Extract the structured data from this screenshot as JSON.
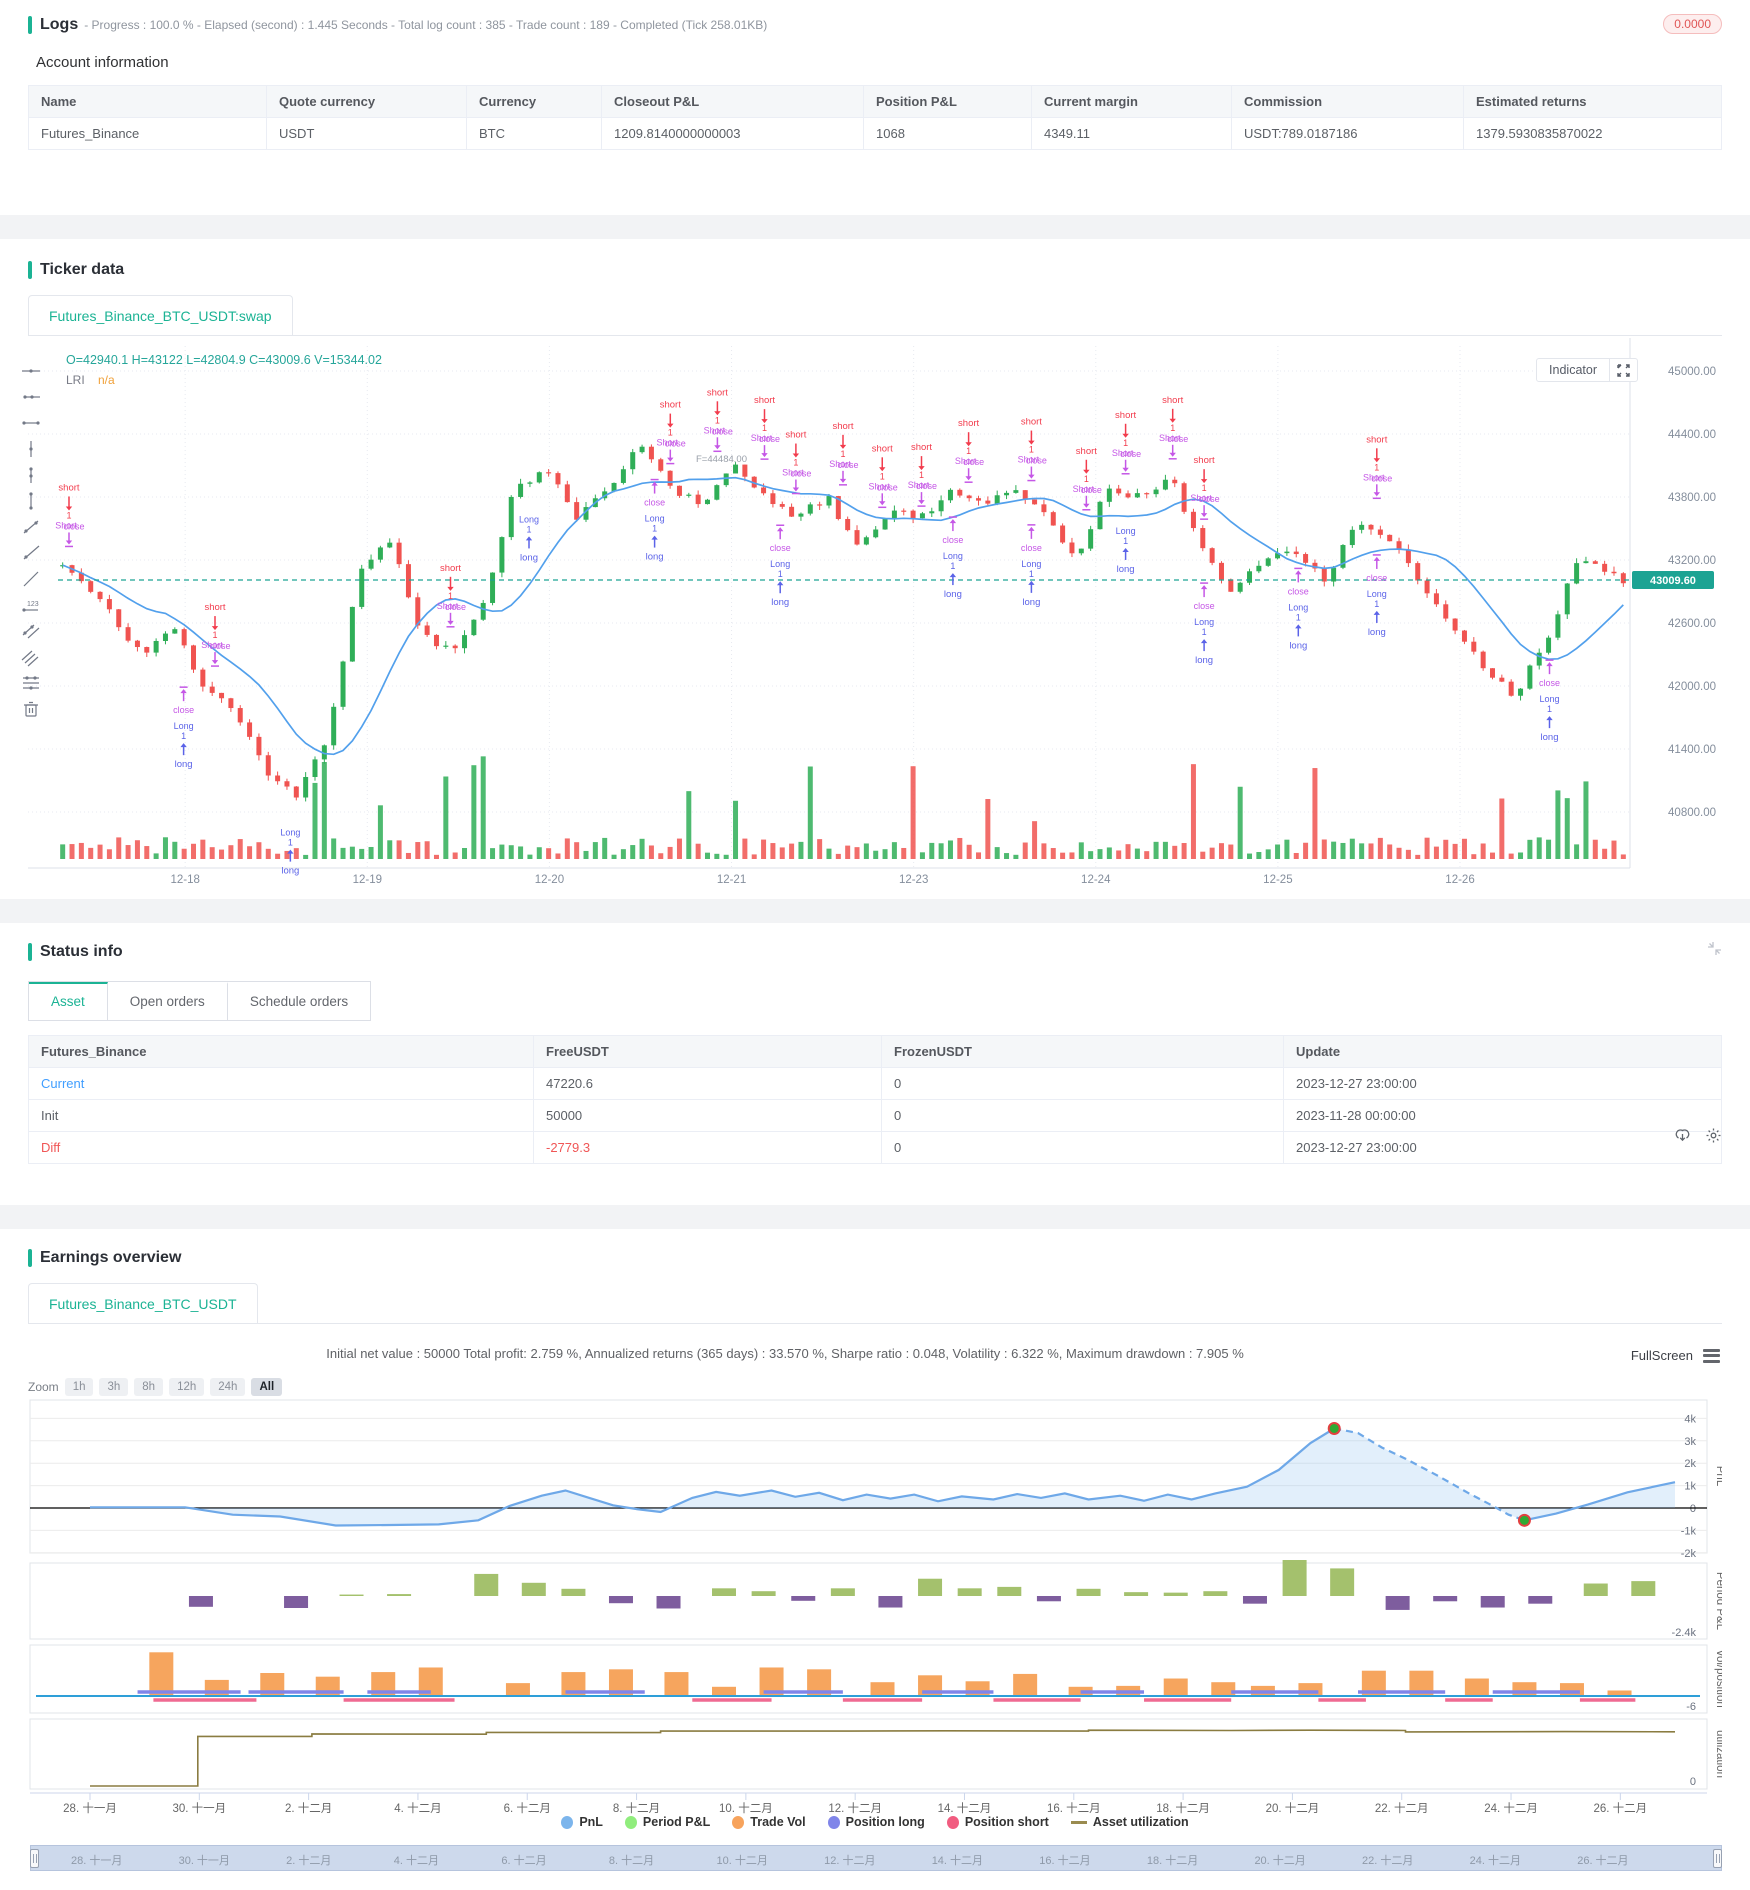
{
  "logs": {
    "title": "Logs",
    "meta": "- Progress : 100.0 % - Elapsed (second) : 1.445  Seconds - Total log count : 385 - Trade count : 189 - Completed (Tick 258.01KB)",
    "badge": "0.0000"
  },
  "account": {
    "subtitle": "Account information",
    "columns": [
      "Name",
      "Quote currency",
      "Currency",
      "Closeout P&L",
      "Position P&L",
      "Current margin",
      "Commission",
      "Estimated returns"
    ],
    "rows": [
      [
        "Futures_Binance",
        "USDT",
        "BTC",
        "1209.8140000000003",
        "1068",
        "4349.11",
        "USDT:789.0187186",
        "1379.5930835870022"
      ]
    ]
  },
  "ticker": {
    "title": "Ticker data",
    "tab": "Futures_Binance_BTC_USDT:swap",
    "ohlc_legend": "O=42940.1 H=43122 L=42804.9 C=43009.6 V=15344.02",
    "indicator_name": "LRI",
    "indicator_value": "n/a",
    "indicator_button": "Indicator",
    "annotation": "F=44484.00",
    "price_tag": "43009.60",
    "toolbar_icons": [
      "crosshair-line",
      "horizontal-ray",
      "horizontal-segment",
      "vertical-line",
      "vertical-ray",
      "vertical-segment",
      "trend-line",
      "ray-line",
      "arrow-line",
      "measure-123",
      "parallel-channel",
      "triple-lines",
      "fib-lines",
      "trash"
    ]
  },
  "status": {
    "title": "Status info",
    "tabs": [
      "Asset",
      "Open orders",
      "Schedule orders"
    ],
    "active_tab": "Asset",
    "columns": [
      "Futures_Binance",
      "FreeUSDT",
      "FrozenUSDT",
      "Update"
    ],
    "rows": [
      {
        "label": "Current",
        "style": "blue",
        "cells": [
          "47220.6",
          "0",
          "2023-12-27 23:00:00"
        ],
        "value_style": ""
      },
      {
        "label": "Init",
        "style": "",
        "cells": [
          "50000",
          "0",
          "2023-11-28 00:00:00"
        ],
        "value_style": ""
      },
      {
        "label": "Diff",
        "style": "red",
        "cells": [
          "-2779.3",
          "0",
          "2023-12-27 23:00:00"
        ],
        "value_style": "red"
      }
    ]
  },
  "earnings": {
    "title": "Earnings overview",
    "tab": "Futures_Binance_BTC_USDT",
    "stats": "Initial net value : 50000 Total profit: 2.759 %, Annualized returns (365 days) : 33.570 %, Sharpe ratio : 0.048, Volatility : 6.322 %, Maximum drawdown : 7.905 %",
    "fullscreen": "FullScreen",
    "zoom_label": "Zoom",
    "zoom_buttons": [
      "1h",
      "3h",
      "8h",
      "12h",
      "24h",
      "All"
    ],
    "active_zoom": "All"
  },
  "chart_data": [
    {
      "type": "candlestick",
      "title": "Futures_Binance_BTC_USDT:swap",
      "ohlc": {
        "open": 42940.1,
        "high": 43122,
        "low": 42804.9,
        "close": 43009.6,
        "volume": 15344.02
      },
      "current_price": 43009.6,
      "y_ticks": [
        "45000.00",
        "44400.00",
        "43800.00",
        "43200.00",
        "42600.00",
        "42000.00",
        "41400.00",
        "40800.00"
      ],
      "y_values": [
        45000,
        44400,
        43800,
        43200,
        42600,
        42000,
        41400,
        40800
      ],
      "x_labels": [
        "12-18",
        "12-19",
        "12-20",
        "12-21",
        "12-23",
        "12-24",
        "12-25",
        "12-26"
      ],
      "x_fractions": [
        0.081,
        0.197,
        0.313,
        0.429,
        0.545,
        0.661,
        0.777,
        0.893
      ],
      "price_anchors": [
        [
          0,
          43150
        ],
        [
          0.02,
          42900
        ],
        [
          0.05,
          42300
        ],
        [
          0.07,
          42600
        ],
        [
          0.09,
          42000
        ],
        [
          0.11,
          41800
        ],
        [
          0.13,
          41200
        ],
        [
          0.15,
          40950
        ],
        [
          0.17,
          41500
        ],
        [
          0.19,
          43100
        ],
        [
          0.21,
          43400
        ],
        [
          0.23,
          42500
        ],
        [
          0.25,
          42300
        ],
        [
          0.27,
          42800
        ],
        [
          0.29,
          43900
        ],
        [
          0.31,
          44050
        ],
        [
          0.33,
          43600
        ],
        [
          0.35,
          43900
        ],
        [
          0.37,
          44300
        ],
        [
          0.39,
          43900
        ],
        [
          0.41,
          43700
        ],
        [
          0.43,
          44100
        ],
        [
          0.45,
          43800
        ],
        [
          0.47,
          43600
        ],
        [
          0.49,
          43800
        ],
        [
          0.51,
          43300
        ],
        [
          0.53,
          43700
        ],
        [
          0.55,
          43600
        ],
        [
          0.57,
          43900
        ],
        [
          0.59,
          43700
        ],
        [
          0.61,
          43900
        ],
        [
          0.63,
          43600
        ],
        [
          0.65,
          43200
        ],
        [
          0.67,
          43900
        ],
        [
          0.69,
          43800
        ],
        [
          0.71,
          44000
        ],
        [
          0.73,
          43300
        ],
        [
          0.75,
          42900
        ],
        [
          0.77,
          43200
        ],
        [
          0.79,
          43300
        ],
        [
          0.81,
          43000
        ],
        [
          0.83,
          43600
        ],
        [
          0.85,
          43400
        ],
        [
          0.87,
          43000
        ],
        [
          0.89,
          42600
        ],
        [
          0.91,
          42200
        ],
        [
          0.93,
          41900
        ],
        [
          0.95,
          42400
        ],
        [
          0.97,
          43200
        ],
        [
          1,
          43010
        ]
      ],
      "markers": {
        "sell": [
          0.007,
          0.1,
          0.25,
          0.39,
          0.42,
          0.45,
          0.47,
          0.5,
          0.525,
          0.55,
          0.58,
          0.62,
          0.655,
          0.68,
          0.71,
          0.73,
          0.84
        ],
        "buy": [
          0.08,
          0.148,
          0.3,
          0.38,
          0.46,
          0.57,
          0.62,
          0.68,
          0.73,
          0.79,
          0.84,
          0.95
        ]
      },
      "seed": 11,
      "colors": {
        "up": "#2fae57",
        "down": "#f05350",
        "ma": "#52a0ec",
        "price_line": "#1ca393",
        "short": "#f23c4d",
        "close": "#c557e6",
        "long": "#5b63e8"
      }
    },
    {
      "type": "multi-panel",
      "panels": [
        "PnL",
        "Period P&L",
        "vol/position",
        "utilization"
      ],
      "pnl": {
        "y_ticks": [
          "4k",
          "3k",
          "2k",
          "1k",
          "0",
          "-1k",
          "-2k"
        ],
        "points": [
          [
            0,
            0.03
          ],
          [
            0.06,
            0.03
          ],
          [
            0.09,
            -0.3
          ],
          [
            0.12,
            -0.38
          ],
          [
            0.155,
            -0.78
          ],
          [
            0.19,
            -0.76
          ],
          [
            0.22,
            -0.73
          ],
          [
            0.245,
            -0.55
          ],
          [
            0.265,
            0.1
          ],
          [
            0.285,
            0.55
          ],
          [
            0.3,
            0.78
          ],
          [
            0.315,
            0.45
          ],
          [
            0.33,
            0.12
          ],
          [
            0.345,
            -0.05
          ],
          [
            0.36,
            -0.18
          ],
          [
            0.38,
            0.45
          ],
          [
            0.395,
            0.72
          ],
          [
            0.41,
            0.55
          ],
          [
            0.43,
            0.78
          ],
          [
            0.445,
            0.5
          ],
          [
            0.46,
            0.68
          ],
          [
            0.475,
            0.35
          ],
          [
            0.49,
            0.6
          ],
          [
            0.505,
            0.42
          ],
          [
            0.52,
            0.6
          ],
          [
            0.535,
            0.3
          ],
          [
            0.55,
            0.52
          ],
          [
            0.57,
            0.38
          ],
          [
            0.585,
            0.62
          ],
          [
            0.6,
            0.45
          ],
          [
            0.615,
            0.65
          ],
          [
            0.63,
            0.38
          ],
          [
            0.65,
            0.55
          ],
          [
            0.665,
            0.32
          ],
          [
            0.68,
            0.6
          ],
          [
            0.695,
            0.38
          ],
          [
            0.71,
            0.65
          ],
          [
            0.73,
            0.95
          ],
          [
            0.75,
            1.7
          ],
          [
            0.77,
            2.9
          ],
          [
            0.785,
            3.55
          ],
          [
            0.8,
            3.35
          ],
          [
            0.815,
            2.7
          ],
          [
            0.83,
            2.2
          ],
          [
            0.85,
            1.45
          ],
          [
            0.87,
            0.65
          ],
          [
            0.885,
            0.1
          ],
          [
            0.895,
            -0.3
          ],
          [
            0.905,
            -0.55
          ],
          [
            0.925,
            -0.25
          ],
          [
            0.945,
            0.15
          ],
          [
            0.97,
            0.7
          ],
          [
            1,
            1.15
          ]
        ],
        "peak_f": 0.785,
        "trough_f": 0.905
      },
      "period_pnl": {
        "min_label": "-2.4k",
        "bars": [
          [
            0.07,
            -0.45
          ],
          [
            0.13,
            -0.5
          ],
          [
            0.165,
            0.06
          ],
          [
            0.195,
            0.08
          ],
          [
            0.25,
            0.92
          ],
          [
            0.28,
            0.55
          ],
          [
            0.305,
            0.3
          ],
          [
            0.335,
            -0.3
          ],
          [
            0.365,
            -0.52
          ],
          [
            0.4,
            0.32
          ],
          [
            0.425,
            0.2
          ],
          [
            0.45,
            -0.2
          ],
          [
            0.475,
            0.32
          ],
          [
            0.505,
            -0.48
          ],
          [
            0.53,
            0.72
          ],
          [
            0.555,
            0.32
          ],
          [
            0.58,
            0.38
          ],
          [
            0.605,
            -0.22
          ],
          [
            0.63,
            0.3
          ],
          [
            0.66,
            0.16
          ],
          [
            0.685,
            0.14
          ],
          [
            0.71,
            0.2
          ],
          [
            0.735,
            -0.32
          ],
          [
            0.76,
            1.5
          ],
          [
            0.79,
            1.15
          ],
          [
            0.825,
            -0.58
          ],
          [
            0.855,
            -0.22
          ],
          [
            0.885,
            -0.48
          ],
          [
            0.915,
            -0.32
          ],
          [
            0.95,
            0.52
          ],
          [
            0.98,
            0.62
          ]
        ]
      },
      "vol_position": {
        "min_label": "-6",
        "vol_bars": [
          [
            0.045,
            0.95
          ],
          [
            0.08,
            0.35
          ],
          [
            0.115,
            0.5
          ],
          [
            0.15,
            0.42
          ],
          [
            0.185,
            0.52
          ],
          [
            0.215,
            0.62
          ],
          [
            0.27,
            0.28
          ],
          [
            0.305,
            0.52
          ],
          [
            0.335,
            0.58
          ],
          [
            0.37,
            0.52
          ],
          [
            0.4,
            0.2
          ],
          [
            0.43,
            0.62
          ],
          [
            0.46,
            0.58
          ],
          [
            0.5,
            0.3
          ],
          [
            0.53,
            0.45
          ],
          [
            0.56,
            0.32
          ],
          [
            0.59,
            0.48
          ],
          [
            0.625,
            0.2
          ],
          [
            0.655,
            0.22
          ],
          [
            0.685,
            0.38
          ],
          [
            0.715,
            0.3
          ],
          [
            0.74,
            0.22
          ],
          [
            0.77,
            0.28
          ],
          [
            0.81,
            0.55
          ],
          [
            0.84,
            0.55
          ],
          [
            0.875,
            0.38
          ],
          [
            0.905,
            0.3
          ],
          [
            0.935,
            0.28
          ],
          [
            0.965,
            0.12
          ]
        ],
        "long_segments": [
          [
            0.03,
            0.095
          ],
          [
            0.1,
            0.16
          ],
          [
            0.175,
            0.215
          ],
          [
            0.3,
            0.35
          ],
          [
            0.425,
            0.475
          ],
          [
            0.525,
            0.57
          ],
          [
            0.625,
            0.665
          ],
          [
            0.72,
            0.775
          ],
          [
            0.8,
            0.855
          ],
          [
            0.885,
            0.94
          ]
        ],
        "short_segments": [
          [
            0.04,
            0.105
          ],
          [
            0.16,
            0.23
          ],
          [
            0.38,
            0.43
          ],
          [
            0.475,
            0.525
          ],
          [
            0.57,
            0.625
          ],
          [
            0.665,
            0.72
          ],
          [
            0.775,
            0.805
          ],
          [
            0.855,
            0.885
          ],
          [
            0.94,
            0.975
          ]
        ]
      },
      "utilization": {
        "min_label": "0",
        "steps": [
          [
            0,
            0
          ],
          [
            0.068,
            0
          ],
          [
            0.068,
            0.8
          ],
          [
            0.14,
            0.8
          ],
          [
            0.14,
            0.84
          ],
          [
            0.25,
            0.835
          ],
          [
            0.25,
            0.865
          ],
          [
            0.36,
            0.862
          ],
          [
            0.36,
            0.885
          ],
          [
            0.48,
            0.885
          ],
          [
            0.54,
            0.89
          ],
          [
            0.63,
            0.885
          ],
          [
            0.63,
            0.9
          ],
          [
            0.72,
            0.895
          ],
          [
            0.77,
            0.9
          ],
          [
            0.83,
            0.895
          ],
          [
            0.83,
            0.872
          ],
          [
            0.93,
            0.878
          ],
          [
            1,
            0.875
          ]
        ]
      },
      "x_labels": [
        "28. 十一月",
        "30. 十一月",
        "2. 十二月",
        "4. 十二月",
        "6. 十二月",
        "8. 十二月",
        "10. 十二月",
        "12. 十二月",
        "14. 十二月",
        "16. 十二月",
        "18. 十二月",
        "20. 十二月",
        "22. 十二月",
        "24. 十二月",
        "26. 十二月"
      ],
      "legend": [
        {
          "label": "PnL",
          "color": "#7cb5ec",
          "marker": "circle"
        },
        {
          "label": "Period P&L",
          "color": "#90ed7d",
          "marker": "circle"
        },
        {
          "label": "Trade Vol",
          "color": "#f7a35c",
          "marker": "circle"
        },
        {
          "label": "Position long",
          "color": "#8085e9",
          "marker": "circle"
        },
        {
          "label": "Position short",
          "color": "#f15c80",
          "marker": "circle"
        },
        {
          "label": "Asset utilization",
          "color": "#9a8b4f",
          "marker": "line"
        }
      ],
      "colors": {
        "pnl_line": "#6ea8e8",
        "pnl_fill": "rgba(124,181,236,0.22)",
        "bar_pos": "#a4c16d",
        "bar_neg": "#7e5d9e",
        "vol": "#f6a55e",
        "baseline": "#2e9fd8",
        "pos_long": "#8085e9",
        "pos_short": "#ef6a92",
        "util": "#8a7c41",
        "dot_fill": "#2faa33",
        "dot_stroke": "#e34040"
      }
    }
  ]
}
